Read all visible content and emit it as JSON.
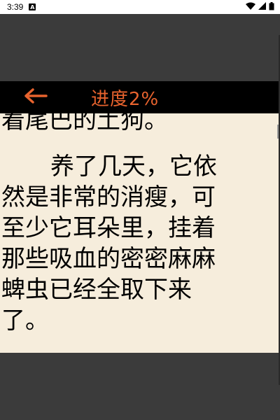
{
  "status_bar": {
    "time": "3:39",
    "notification_icon": "A",
    "icons": [
      "wifi-icon",
      "signal-icon",
      "battery-icon"
    ]
  },
  "toolbar": {
    "back_icon": "arrow-left-icon",
    "title": "进度2%",
    "accent_color": "#e8632e"
  },
  "content": {
    "lines": [
      "着尾巴的土狗。",
      "养了几天，它依",
      "然是非常的消瘦，可",
      "至少它耳朵里，挂着",
      "那些吸血的密密麻麻",
      "蜱虫已经全取下来",
      "了。"
    ]
  },
  "colors": {
    "page_background": "#f6eddc",
    "frame": "#3b3b3b",
    "toolbar": "#000000"
  }
}
